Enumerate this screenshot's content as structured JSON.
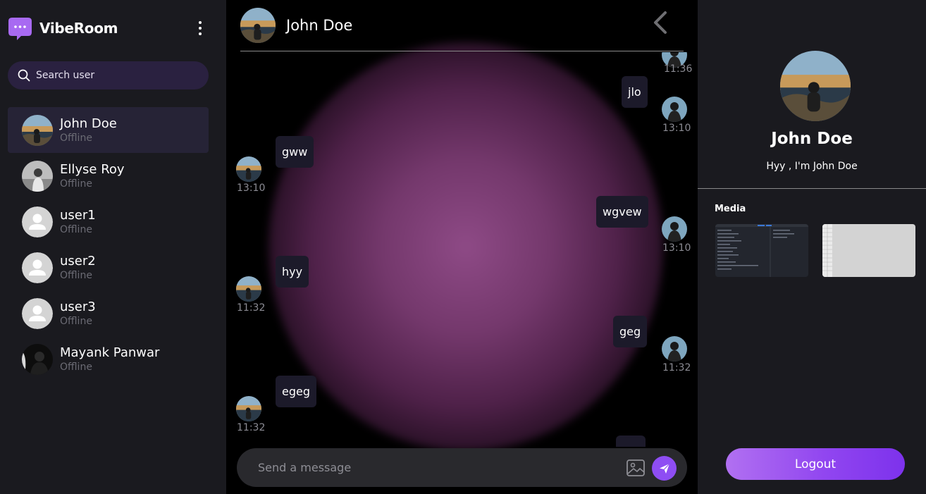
{
  "app": {
    "name": "VibeRoom"
  },
  "colors": {
    "accent": "#8e4df3",
    "sidebar_bg": "#1a1a1f",
    "active_item_bg": "#262336",
    "bubble_bg": "#1c1a2a"
  },
  "sidebar": {
    "menu_icon": "kebab-menu-icon",
    "search": {
      "placeholder": "Search user",
      "icon": "search-icon"
    },
    "users": [
      {
        "name": "John Doe",
        "status": "Offline",
        "avatar": "landscape-photo",
        "active": true
      },
      {
        "name": "Ellyse Roy",
        "status": "Offline",
        "avatar": "grayscale-portrait"
      },
      {
        "name": "user1",
        "status": "Offline",
        "avatar": "default-user-icon"
      },
      {
        "name": "user2",
        "status": "Offline",
        "avatar": "default-user-icon"
      },
      {
        "name": "user3",
        "status": "Offline",
        "avatar": "default-user-icon"
      },
      {
        "name": "Mayank Panwar",
        "status": "Offline",
        "avatar": "dark-portrait"
      }
    ]
  },
  "chat": {
    "header": {
      "name": "John Doe",
      "back_icon": "chevron-left-icon"
    },
    "messages": [
      {
        "side": "right",
        "text": "",
        "time": "11:36"
      },
      {
        "side": "right",
        "text": "jlo",
        "time": "13:10"
      },
      {
        "side": "left",
        "text": "gww",
        "time": "13:10"
      },
      {
        "side": "right",
        "text": "wgvew",
        "time": "13:10"
      },
      {
        "side": "left",
        "text": "hyy",
        "time": "11:32"
      },
      {
        "side": "right",
        "text": "geg",
        "time": "11:32"
      },
      {
        "side": "left",
        "text": "egeg",
        "time": "11:32"
      },
      {
        "side": "right",
        "text": "",
        "time": ""
      }
    ],
    "composer": {
      "placeholder": "Send a message",
      "image_icon": "image-icon",
      "send_icon": "send-icon"
    }
  },
  "profile": {
    "name": "John Doe",
    "bio": "Hyy , I'm John Doe",
    "media_title": "Media",
    "logout_label": "Logout"
  }
}
